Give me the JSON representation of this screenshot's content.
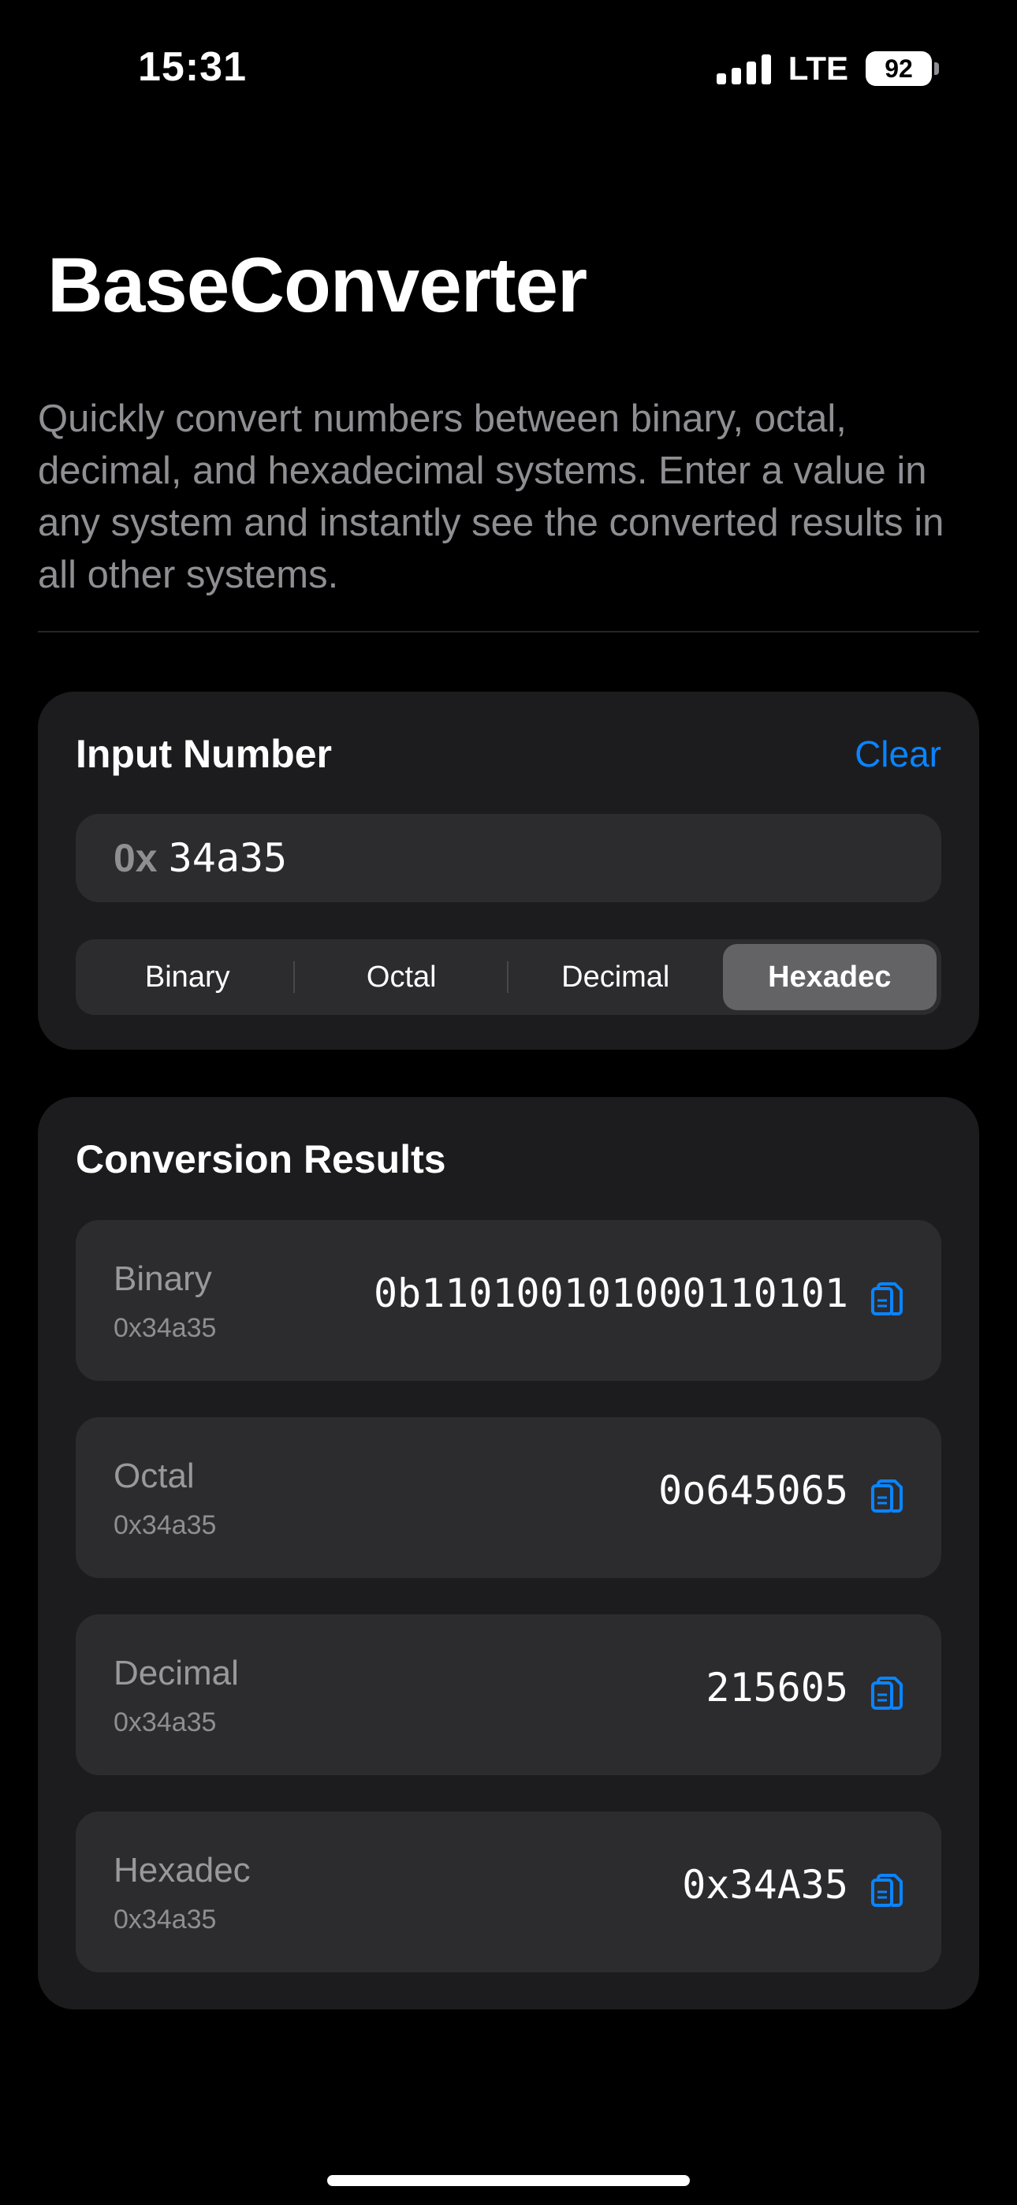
{
  "status_bar": {
    "time": "15:31",
    "network": "LTE",
    "battery": "92"
  },
  "header": {
    "title": "BaseConverter",
    "description": "Quickly convert numbers between binary, octal, decimal, and hexadecimal systems. Enter a value in any system and instantly see the converted results in all other systems."
  },
  "input_card": {
    "title": "Input Number",
    "clear_label": "Clear",
    "prefix": "0x",
    "value": "34a35",
    "segments": [
      {
        "label": "Binary",
        "active": false
      },
      {
        "label": "Octal",
        "active": false
      },
      {
        "label": "Decimal",
        "active": false
      },
      {
        "label": "Hexadec",
        "active": true
      }
    ]
  },
  "results_card": {
    "title": "Conversion Results",
    "rows": [
      {
        "label": "Binary",
        "source": "0x34a35",
        "value": "0b110100101000110101"
      },
      {
        "label": "Octal",
        "source": "0x34a35",
        "value": "0o645065"
      },
      {
        "label": "Decimal",
        "source": "0x34a35",
        "value": "215605"
      },
      {
        "label": "Hexadec",
        "source": "0x34a35",
        "value": "0x34A35"
      }
    ]
  },
  "colors": {
    "accent": "#0a84ff",
    "background": "#000000",
    "card": "#1c1c1e",
    "row": "#2c2c2e"
  },
  "icons": {
    "copy": "copy-icon"
  }
}
